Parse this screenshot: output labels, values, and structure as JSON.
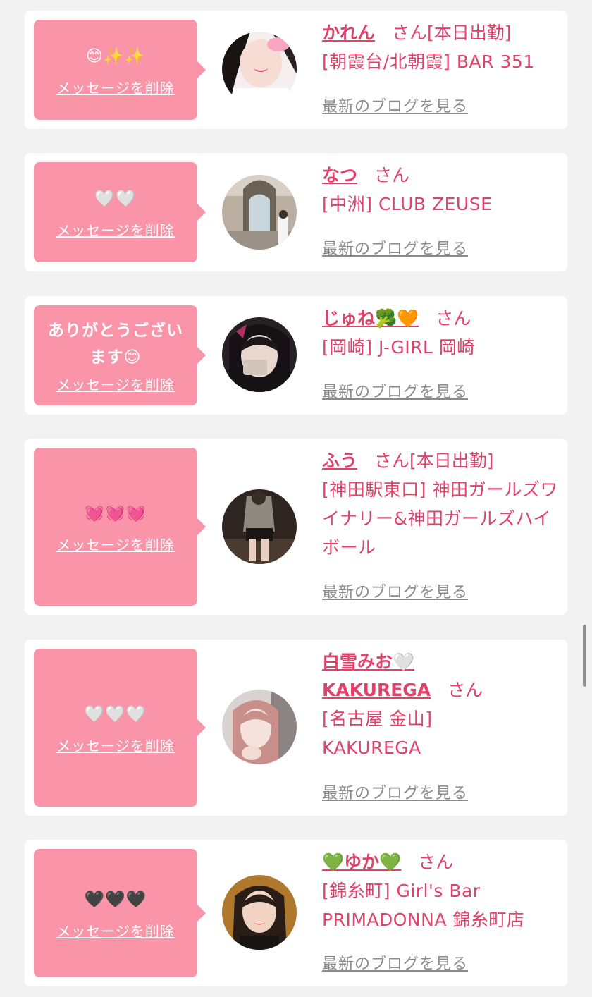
{
  "common": {
    "delete_label": "メッセージを削除",
    "blog_label": "最新のブログを見る",
    "honorific": "さん"
  },
  "cards": [
    {
      "message": "😊✨✨",
      "name": "かれん",
      "status": "[本日出勤]",
      "shop": "[朝霞台/北朝霞] BAR 351"
    },
    {
      "message": "🤍🤍",
      "name": "なつ",
      "status": "",
      "shop": "[中洲] CLUB ZEUSE"
    },
    {
      "message": "ありがとうございます😊",
      "name": "じゅね🥦🧡",
      "status": "",
      "shop": "[岡崎] J-GIRL 岡崎"
    },
    {
      "message": "💓💓💓",
      "name": "ふう",
      "status": "[本日出勤]",
      "shop": "[神田駅東口] 神田ガールズワイナリー&神田ガールズハイボール"
    },
    {
      "message": "🤍🤍🤍",
      "name": "白雪みお🤍KAKUREGA",
      "status": "",
      "shop": "[名古屋 金山] KAKUREGA"
    },
    {
      "message": "🖤🖤🖤",
      "name": "💚ゆか💚",
      "status": "",
      "shop": "[錦糸町] Girl's Bar PRIMADONNA 錦糸町店"
    }
  ],
  "colors": {
    "bubble": "#fa94a8",
    "accent": "#e0426a",
    "link_gray": "#8a8a8a",
    "background": "#f2f2f2"
  }
}
